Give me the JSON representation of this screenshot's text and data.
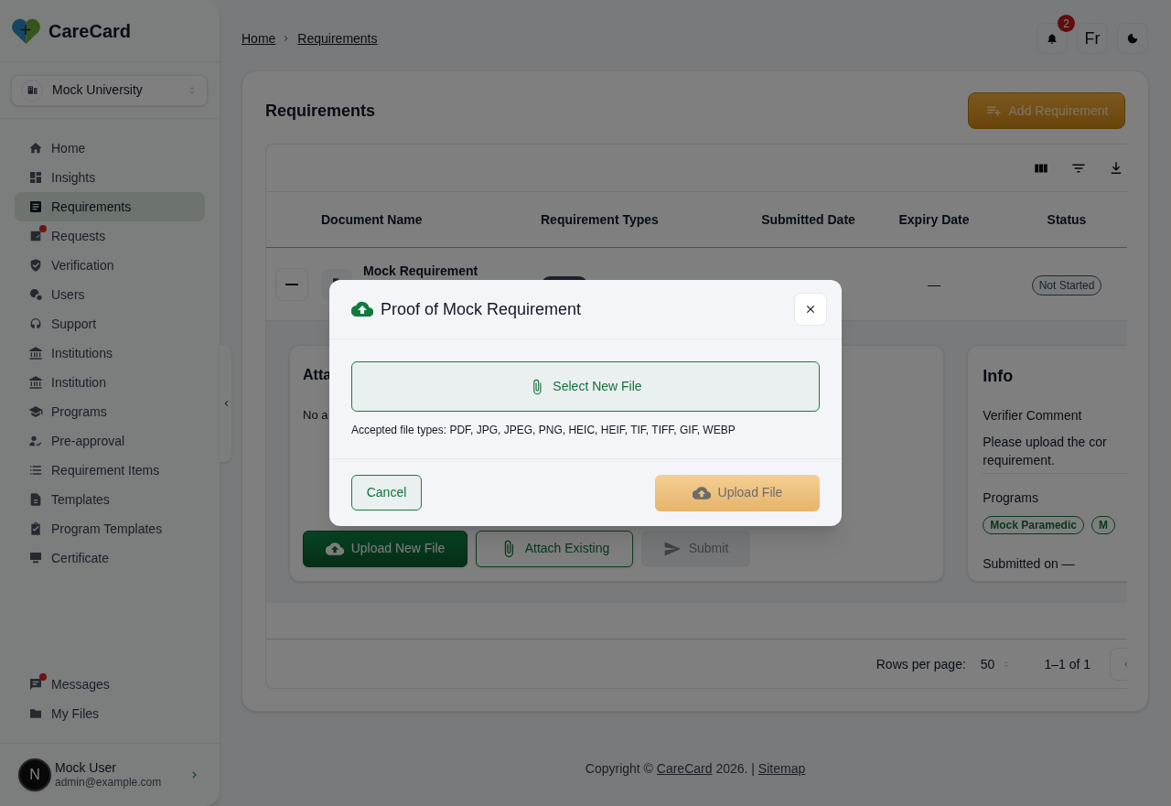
{
  "brand": {
    "name": "CareCard"
  },
  "org_selector": {
    "value": "Mock University"
  },
  "sidebar": {
    "items": [
      {
        "label": "Home",
        "selected": false,
        "dot": false
      },
      {
        "label": "Insights",
        "selected": false,
        "dot": false
      },
      {
        "label": "Requirements",
        "selected": true,
        "dot": false
      },
      {
        "label": "Requests",
        "selected": false,
        "dot": true
      },
      {
        "label": "Verification",
        "selected": false,
        "dot": false
      },
      {
        "label": "Users",
        "selected": false,
        "dot": false
      },
      {
        "label": "Support",
        "selected": false,
        "dot": false
      },
      {
        "label": "Institutions",
        "selected": false,
        "dot": false
      },
      {
        "label": "Institution",
        "selected": false,
        "dot": false
      },
      {
        "label": "Programs",
        "selected": false,
        "dot": false
      },
      {
        "label": "Pre-approval",
        "selected": false,
        "dot": false
      },
      {
        "label": "Requirement Items",
        "selected": false,
        "dot": false
      },
      {
        "label": "Templates",
        "selected": false,
        "dot": false
      },
      {
        "label": "Program Templates",
        "selected": false,
        "dot": false
      },
      {
        "label": "Certificate",
        "selected": false,
        "dot": false
      }
    ],
    "bottom_items": [
      {
        "label": "Messages",
        "selected": false,
        "dot": true
      },
      {
        "label": "My Files",
        "selected": false,
        "dot": false
      }
    ]
  },
  "user": {
    "avatar_letter": "N",
    "name": "Mock User",
    "email": "admin@example.com"
  },
  "breadcrumb": [
    "Home",
    "Requirements"
  ],
  "topbar": {
    "notification_count": "2",
    "language": "Fr"
  },
  "page": {
    "title": "Requirements",
    "add_button": "Add Requirement"
  },
  "table": {
    "columns": [
      "Document Name",
      "Requirement Types",
      "Submitted Date",
      "Expiry Date",
      "Status"
    ],
    "rows": [
      {
        "expanded": true,
        "document_name": "Mock Requirement",
        "expiry_date": "—",
        "status": "Not Started"
      }
    ],
    "rows_per_page_label": "Rows per page:",
    "rows_per_page": "50",
    "range": "1–1 of 1"
  },
  "attachments": {
    "title": "Atta",
    "empty_text": "No a",
    "buttons": [
      {
        "label": "Upload New File",
        "kind": "primary",
        "disabled": false
      },
      {
        "label": "Attach Existing",
        "kind": "outline",
        "disabled": false
      },
      {
        "label": "Submit",
        "kind": "send",
        "disabled": true
      }
    ]
  },
  "info": {
    "title": "Info",
    "verifier_comment_label": "Verifier Comment",
    "verifier_comment_lines": [
      "Please upload the cor",
      "requirement."
    ],
    "programs_label": "Programs",
    "programs": [
      "Mock Paramedic",
      "M"
    ],
    "submitted": "Submitted on —"
  },
  "footer": {
    "prefix": "Copyright © ",
    "brand_link": "CareCard",
    "middle": " 2026. | ",
    "sitemap_link": "Sitemap"
  },
  "modal": {
    "title": "Proof of Mock Requirement",
    "select_button": "Select New File",
    "accepted": "Accepted file types: PDF, JPG, JPEG, PNG, HEIC, HEIF, TIF, TIFF, GIF, WEBP",
    "cancel": "Cancel",
    "upload": "Upload File",
    "upload_disabled": true
  }
}
